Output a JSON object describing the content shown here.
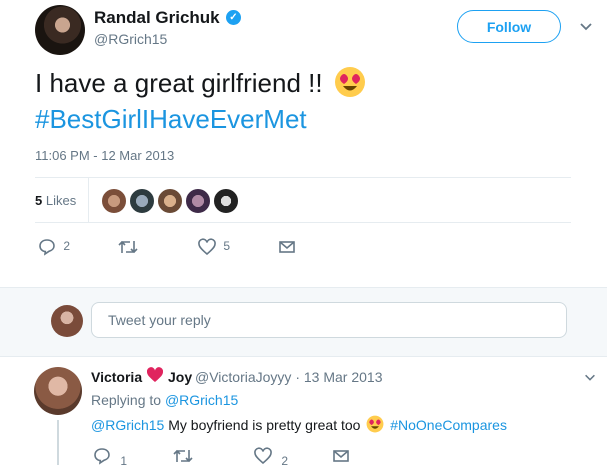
{
  "tweet": {
    "author_name": "Randal Grichuk",
    "handle": "@RGrich15",
    "follow_label": "Follow",
    "text": "I have a great girlfriend !!",
    "hashtag": "#BestGirlIHaveEverMet",
    "timestamp": "11:06 PM - 12 Mar 2013",
    "likes_count": "5",
    "likes_label": "Likes",
    "actions": {
      "reply_count": "2",
      "retweet_count": "",
      "like_count": "5"
    }
  },
  "reply_box": {
    "placeholder": "Tweet your reply"
  },
  "reply": {
    "name_part1": "Victoria",
    "name_part2": "Joy",
    "handle": "@VictoriaJoyyy",
    "date_sep": "·",
    "date": "13 Mar 2013",
    "replying_prefix": "Replying to",
    "replying_to": "@RGrich15",
    "mention": "@RGrich15",
    "text": "My boyfriend is pretty great too",
    "hashtag": "#NoOneCompares",
    "actions": {
      "reply_count": "1",
      "retweet_count": "",
      "like_count": "2"
    }
  },
  "colors": {
    "accent": "#1da1f2",
    "link": "#1b95e0",
    "heart": "#e0245e",
    "muted": "#657786"
  },
  "icons": [
    "verified-icon",
    "chevron-down-icon",
    "heart-eyes-emoji",
    "reply-icon",
    "retweet-icon",
    "like-icon",
    "message-icon",
    "red-heart-icon"
  ]
}
